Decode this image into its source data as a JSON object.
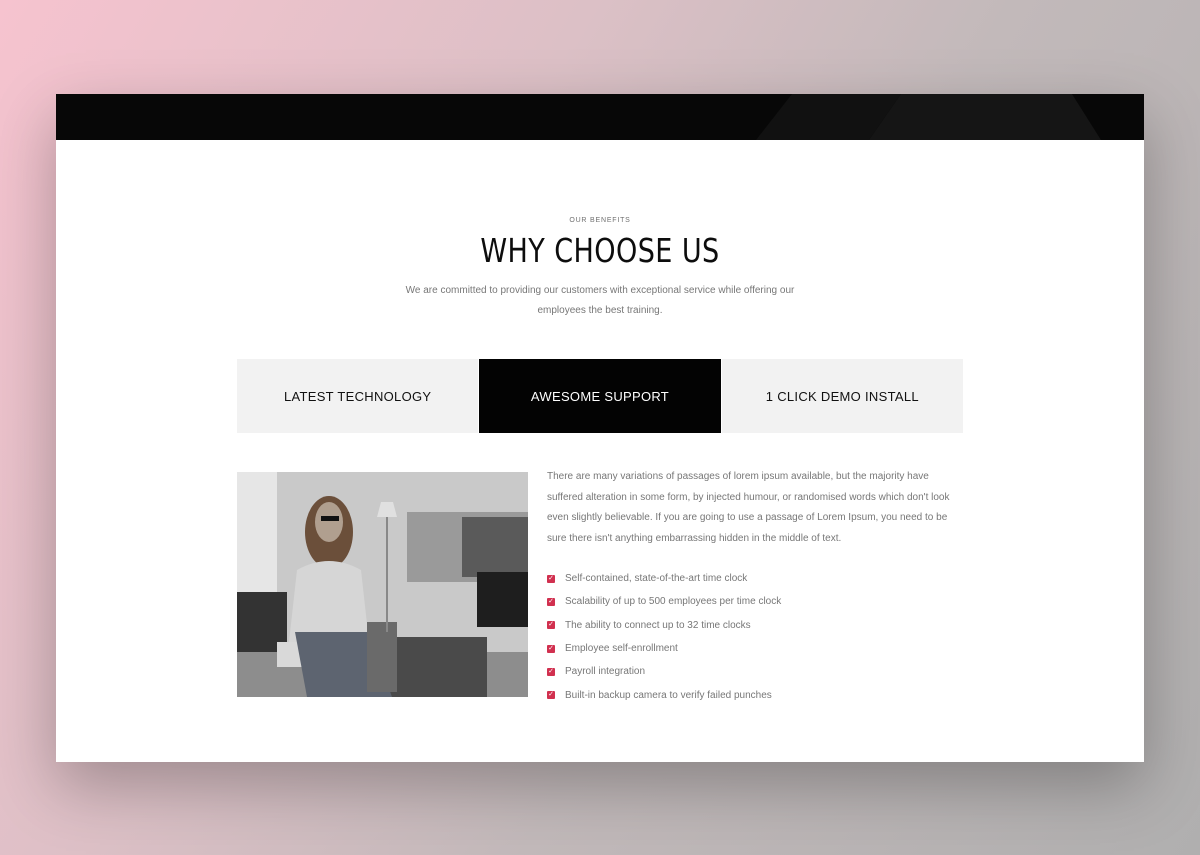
{
  "section": {
    "eyebrow": "OUR BENEFITS",
    "title": "WHY CHOOSE US",
    "lead": "We are committed to providing our customers with exceptional service while offering our employees the best training."
  },
  "tabs": [
    {
      "label": "LATEST TECHNOLOGY",
      "active": false
    },
    {
      "label": "AWESOME SUPPORT",
      "active": true
    },
    {
      "label": "1 CLICK DEMO INSTALL",
      "active": false
    }
  ],
  "content": {
    "paragraph": "There are many variations of passages of lorem ipsum available, but the majority have suffered alteration in some form, by injected humour, or randomised words which don't look even slightly believable. If you are going to use a passage of Lorem Ipsum, you need to be sure there isn't anything embarrassing hidden in the middle of text.",
    "features": [
      "Self-contained, state-of-the-art time clock",
      "Scalability of up to 500 employees per time clock",
      "The ability to connect up to 32 time clocks",
      "Employee self-enrollment",
      "Payroll integration",
      "Built-in backup camera to verify failed punches"
    ]
  },
  "icons": {
    "feature_bullet": "checkbox-checked-icon"
  },
  "colors": {
    "accent": "#d1304f",
    "active_tab": "#030303",
    "tab_bg": "#f2f2f2",
    "text_muted": "#777777"
  }
}
